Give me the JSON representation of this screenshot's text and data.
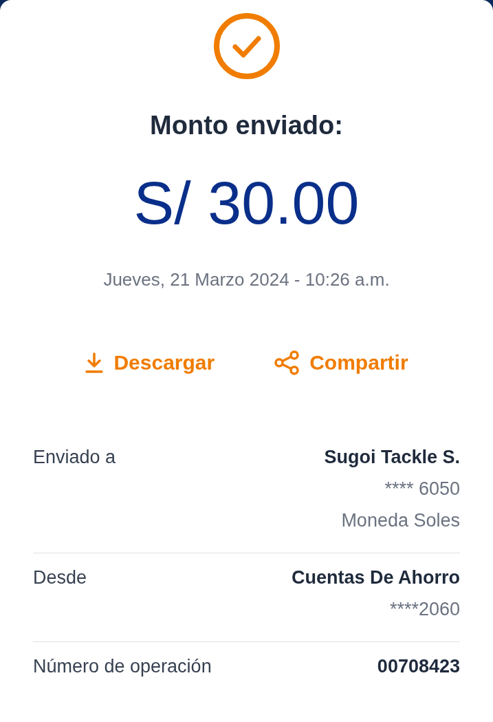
{
  "header": {
    "title": "Monto enviado:",
    "amount": "S/ 30.00",
    "datetime": "Jueves, 21 Marzo 2024 - 10:26 a.m."
  },
  "actions": [
    {
      "kind": "download",
      "label": "Descargar"
    },
    {
      "kind": "share",
      "label": "Compartir"
    }
  ],
  "details": [
    {
      "label": "Enviado a",
      "values": [
        {
          "text": "Sugoi Tackle S.",
          "bold": true
        },
        {
          "text": "**** 6050",
          "bold": false
        },
        {
          "text": "Moneda Soles",
          "bold": false
        }
      ]
    },
    {
      "label": "Desde",
      "values": [
        {
          "text": "Cuentas De Ahorro",
          "bold": true
        },
        {
          "text": "****2060",
          "bold": false
        }
      ]
    },
    {
      "label": "Número de operación",
      "values": [
        {
          "text": "00708423",
          "bold": true
        }
      ]
    }
  ]
}
